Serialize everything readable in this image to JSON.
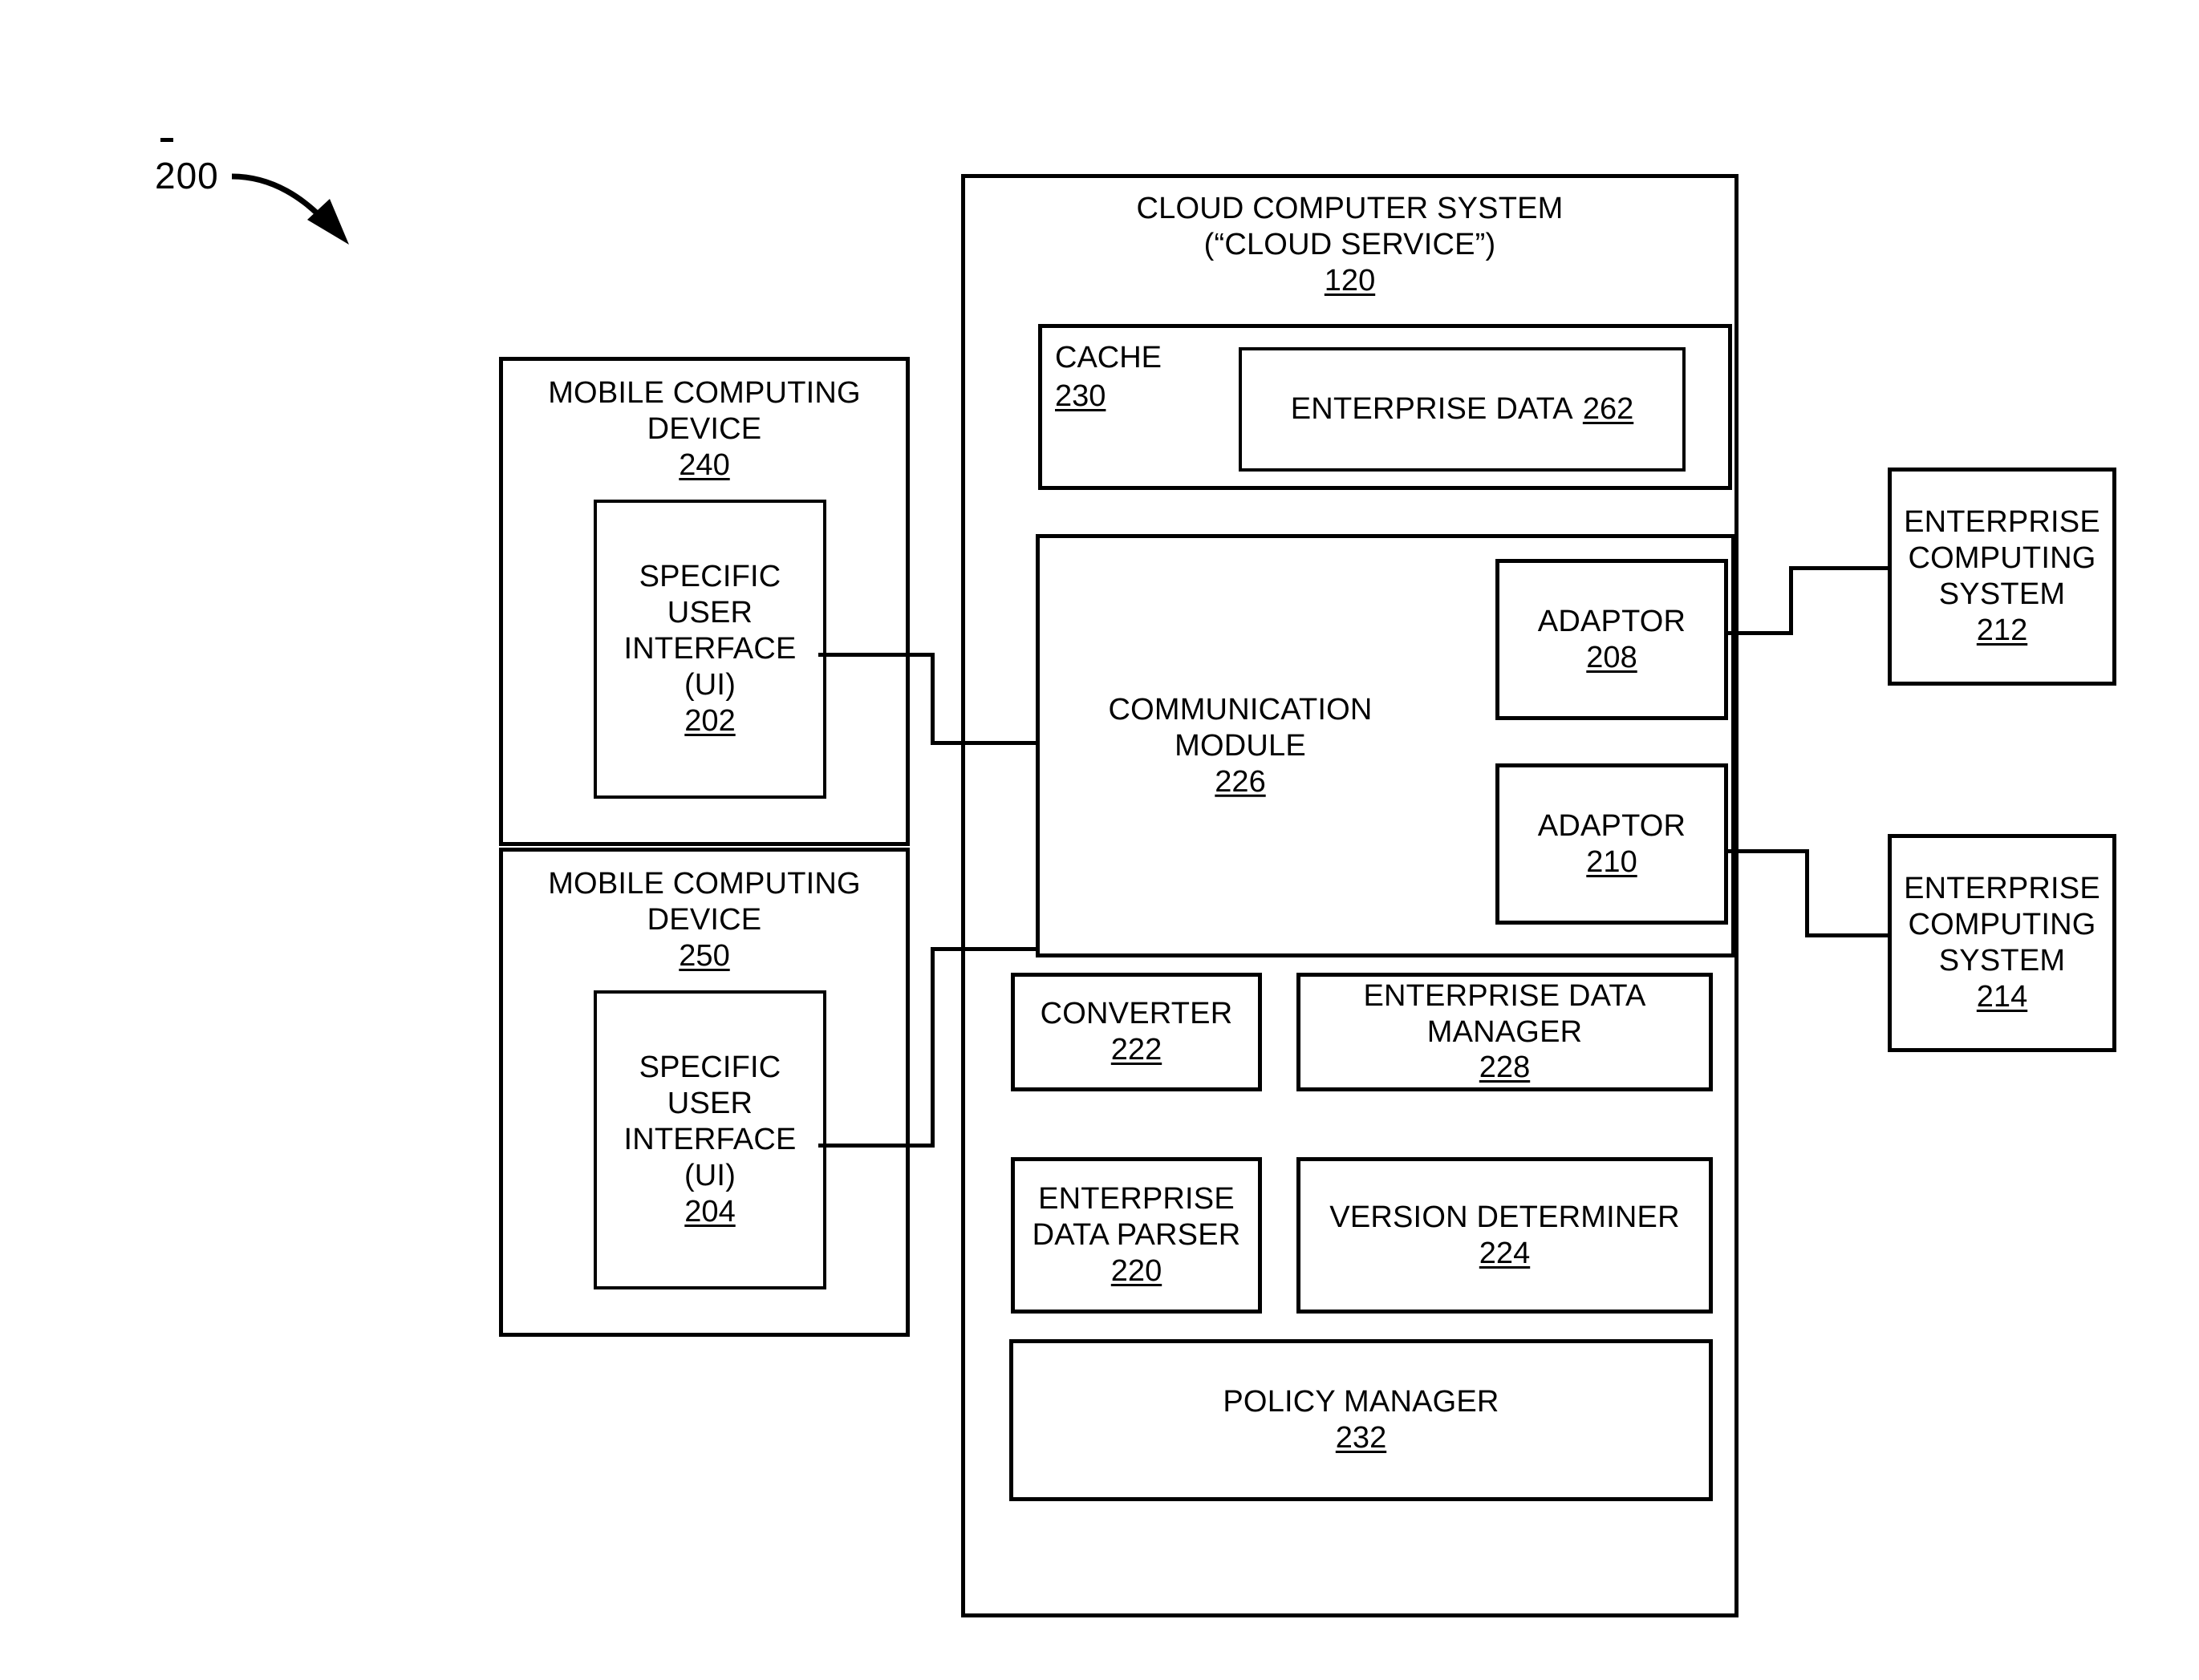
{
  "figure": {
    "number": "200",
    "tick_mark": "-",
    "arrow": "curved-arrow-pointing-down-right"
  },
  "cloud_system": {
    "title_line1": "CLOUD COMPUTER SYSTEM",
    "title_line2": "(“CLOUD SERVICE”)",
    "ref": "120"
  },
  "cache": {
    "label": "CACHE",
    "ref": "230",
    "enterprise_data": {
      "label": "ENTERPRISE DATA",
      "ref": "262"
    }
  },
  "communication_module": {
    "label": "COMMUNICATION\nMODULE",
    "ref": "226",
    "adaptors": [
      {
        "label": "ADAPTOR",
        "ref": "208"
      },
      {
        "label": "ADAPTOR",
        "ref": "210"
      }
    ]
  },
  "modules": [
    {
      "name": "converter",
      "label": "CONVERTER",
      "ref": "222"
    },
    {
      "name": "enterprise-data-manager",
      "label": "ENTERPRISE DATA\nMANAGER",
      "ref": "228"
    },
    {
      "name": "enterprise-data-parser",
      "label": "ENTERPRISE\nDATA PARSER",
      "ref": "220"
    },
    {
      "name": "version-determiner",
      "label": "VERSION DETERMINER",
      "ref": "224"
    },
    {
      "name": "policy-manager",
      "label": "POLICY MANAGER",
      "ref": "232"
    }
  ],
  "mobile_devices": [
    {
      "name": "mobile-computing-device-240",
      "label": "MOBILE COMPUTING\nDEVICE",
      "ref": "240",
      "ui": {
        "label": "SPECIFIC\nUSER\nINTERFACE\n(UI)",
        "ref": "202"
      }
    },
    {
      "name": "mobile-computing-device-250",
      "label": "MOBILE COMPUTING\nDEVICE",
      "ref": "250",
      "ui": {
        "label": "SPECIFIC\nUSER\nINTERFACE\n(UI)",
        "ref": "204"
      }
    }
  ],
  "enterprise_systems": [
    {
      "name": "enterprise-computing-system-212",
      "label": "ENTERPRISE\nCOMPUTING\nSYSTEM",
      "ref": "212"
    },
    {
      "name": "enterprise-computing-system-214",
      "label": "ENTERPRISE\nCOMPUTING\nSYSTEM",
      "ref": "214"
    }
  ],
  "colors": {
    "stroke": "#000000",
    "background": "#ffffff"
  }
}
